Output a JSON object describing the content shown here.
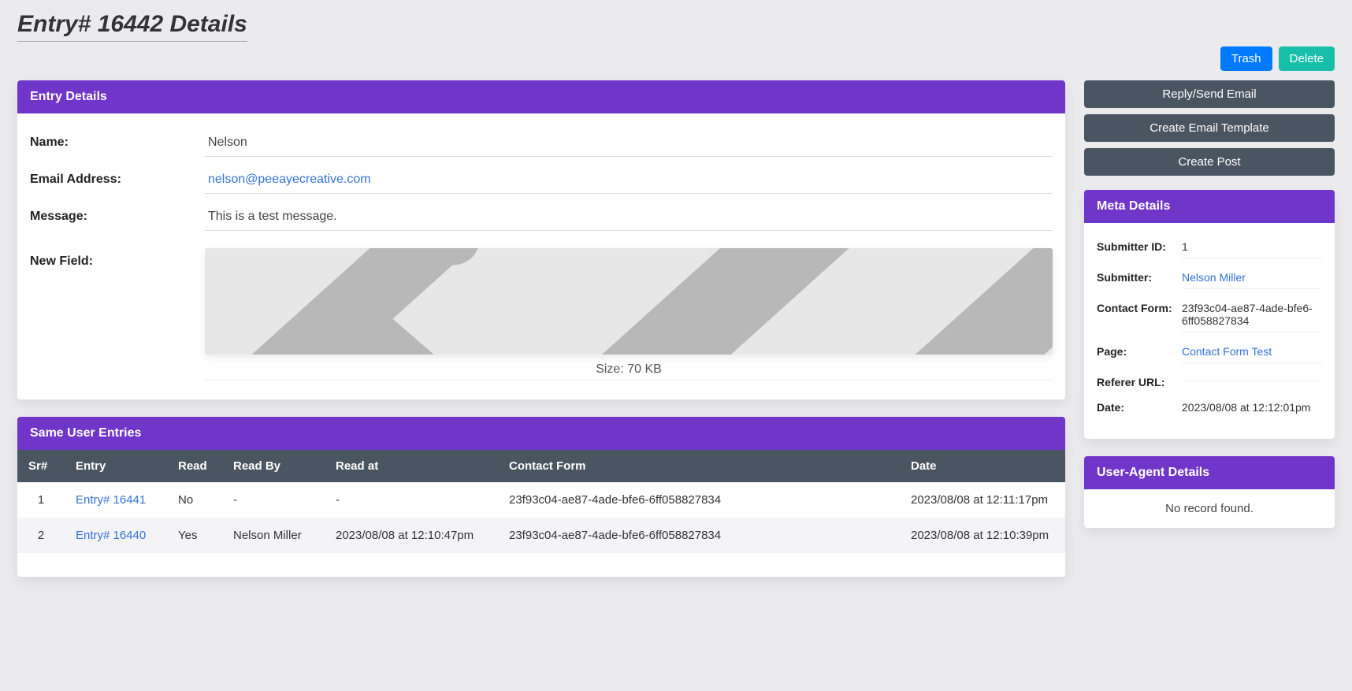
{
  "page_title": "Entry# 16442 Details",
  "top_buttons": {
    "trash": "Trash",
    "delete": "Delete"
  },
  "side_actions": {
    "reply": "Reply/Send Email",
    "create_template": "Create Email Template",
    "create_post": "Create Post"
  },
  "entry_details": {
    "header": "Entry Details",
    "name_label": "Name:",
    "name_value": "Nelson",
    "email_label": "Email Address:",
    "email_value": "nelson@peeayecreative.com",
    "message_label": "Message:",
    "message_value": "This is a test message.",
    "newfield_label": "New Field:",
    "size_caption": "Size: 70 KB"
  },
  "same_user": {
    "header": "Same User Entries",
    "columns": [
      "Sr#",
      "Entry",
      "Read",
      "Read By",
      "Read at",
      "Contact Form",
      "Date"
    ],
    "rows": [
      {
        "sr": "1",
        "entry": "Entry# 16441",
        "read": "No",
        "read_by": "-",
        "read_at": "-",
        "contact_form": "23f93c04-ae87-4ade-bfe6-6ff058827834",
        "date": "2023/08/08 at 12:11:17pm"
      },
      {
        "sr": "2",
        "entry": "Entry# 16440",
        "read": "Yes",
        "read_by": "Nelson Miller",
        "read_at": "2023/08/08 at 12:10:47pm",
        "contact_form": "23f93c04-ae87-4ade-bfe6-6ff058827834",
        "date": "2023/08/08 at 12:10:39pm"
      }
    ]
  },
  "meta": {
    "header": "Meta Details",
    "submitter_id_label": "Submitter ID:",
    "submitter_id_value": "1",
    "submitter_label": "Submitter:",
    "submitter_value": "Nelson Miller",
    "contact_form_label": "Contact Form:",
    "contact_form_value": "23f93c04-ae87-4ade-bfe6-6ff058827834",
    "page_label": "Page:",
    "page_value": "Contact Form Test",
    "referer_label": "Referer URL:",
    "referer_value": "",
    "date_label": "Date:",
    "date_value": "2023/08/08 at 12:12:01pm"
  },
  "user_agent": {
    "header": "User-Agent Details",
    "empty": "No record found."
  }
}
